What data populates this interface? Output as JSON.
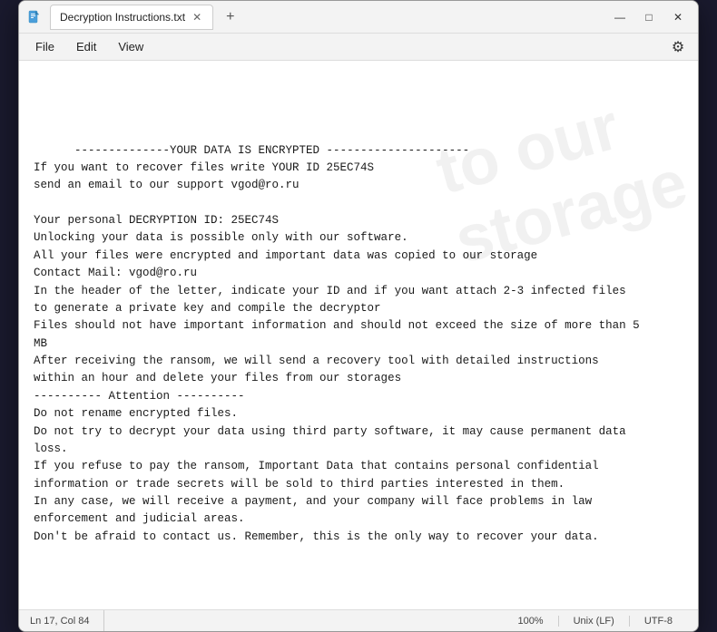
{
  "window": {
    "title": "Decryption Instructions.txt",
    "tab_label": "Decryption Instructions.txt"
  },
  "menu": {
    "file": "File",
    "edit": "Edit",
    "view": "View"
  },
  "content": {
    "text": "--------------YOUR DATA IS ENCRYPTED ---------------------\nIf you want to recover files write YOUR ID 25EC74S\nsend an email to our support vgod@ro.ru\n\nYour personal DECRYPTION ID: 25EC74S\nUnlocking your data is possible only with our software.\nAll your files were encrypted and important data was copied to our storage\nContact Mail: vgod@ro.ru\nIn the header of the letter, indicate your ID and if you want attach 2-3 infected files\nto generate a private key and compile the decryptor\nFiles should not have important information and should not exceed the size of more than 5\nMB\nAfter receiving the ransom, we will send a recovery tool with detailed instructions\nwithin an hour and delete your files from our storages\n---------- Attention ----------\nDo not rename encrypted files.\nDo not try to decrypt your data using third party software, it may cause permanent data\nloss.\nIf you refuse to pay the ransom, Important Data that contains personal confidential\ninformation or trade secrets will be sold to third parties interested in them.\nIn any case, we will receive a payment, and your company will face problems in law\nenforcement and judicial areas.\nDon't be afraid to contact us. Remember, this is the only way to recover your data."
  },
  "status_bar": {
    "position": "Ln 17, Col 84",
    "zoom": "100%",
    "line_ending": "Unix (LF)",
    "encoding": "UTF-8"
  },
  "controls": {
    "minimize": "—",
    "maximize": "□",
    "close": "✕",
    "new_tab": "+",
    "tab_close": "✕"
  },
  "watermark_text": "to our storage"
}
